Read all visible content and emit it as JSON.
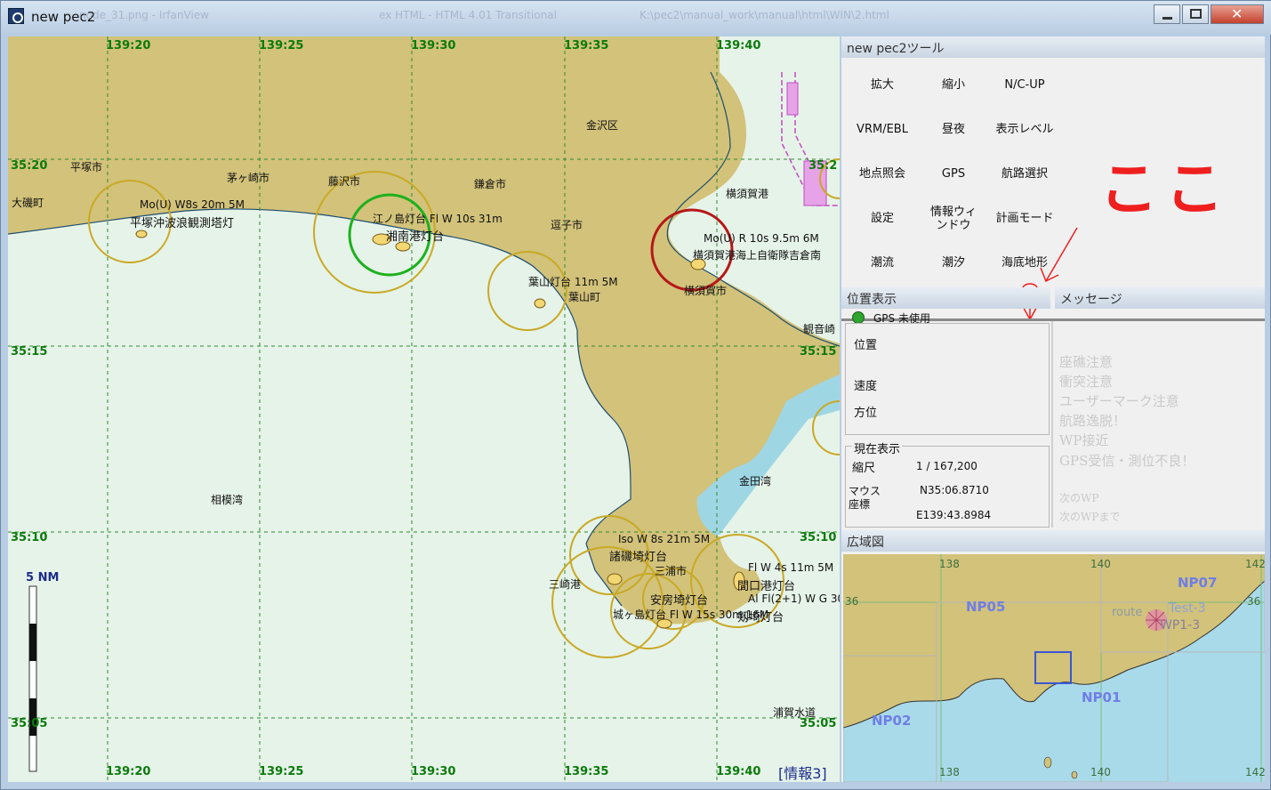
{
  "window": {
    "title": "new pec2",
    "ghost_titles": [
      "node_31.png - IrfanView",
      "ex HTML - HTML 4.01 Transitional",
      "K:\\pec2\\manual_work\\manual\\html\\WIN\\2.html"
    ]
  },
  "map": {
    "top_coords": [
      "139:20",
      "139:25",
      "139:30",
      "139:35",
      "139:40"
    ],
    "bottom_coords": [
      "139:20",
      "139:25",
      "139:30",
      "139:35",
      "139:40"
    ],
    "left_coords": [
      "35:20",
      "35:15",
      "35:10",
      "35:05"
    ],
    "right_coords": [
      "35:2",
      "35:15",
      "35:10",
      "35:05"
    ],
    "place_labels": {
      "hiratsuka": "平塚市",
      "oiso": "大磯町",
      "chigasaki": "茅ヶ崎市",
      "fujisawa": "藤沢市",
      "kamakura": "鎌倉市",
      "kanazawa": "金沢区",
      "zushi": "逗子市",
      "yokosuka_port": "横須賀港",
      "hayama": "葉山町",
      "yokosuka": "横須賀市",
      "kannonzaki": "観音崎",
      "sagami_bay": "相模湾",
      "kaneda_bay": "金田湾",
      "misaki_port": "三崎港",
      "miura": "三浦市",
      "uraga": "浦賀水道"
    },
    "light_labels": {
      "hiratsuka_light": "Mo(U) W8s 20m 5M",
      "hiratsuka_tower": "平塚沖波浪観測塔灯",
      "enoshima": "江ノ島灯台 Fl W 10s 31m",
      "shonan": "湘南港灯台",
      "hayama_light": "葉山灯台 11m 5M",
      "yokosuka_light": "Mo(U) R 10s 9.5m 6M",
      "yokosuka_base": "横須賀港海上自衛隊吉倉南",
      "moroiso_light": "Iso W 8s 21m 5M",
      "moroiso": "諸磯埼灯台",
      "matsuwa_light": "Fl W 4s 11m 5M",
      "mamaguchi": "間口港灯台",
      "tsurugi_light": "Al Fl(2+1) W G 30s",
      "tsurugi": "剱埼灯台",
      "awa": "安房埼灯台",
      "jogashima": "城ヶ島灯台 Fl W 15s 30m 16M"
    },
    "scale_label": "5 NM",
    "info_label": "[情報3]",
    "colors": {
      "land": "#d2c27a",
      "sea": "#e6f3e9",
      "shallow": "#9fd6e4",
      "grid": "#2e8b2e"
    }
  },
  "tools": {
    "header": "new pec2ツール",
    "buttons": [
      {
        "label": "拡大"
      },
      {
        "label": "縮小"
      },
      {
        "label": "N/C-UP"
      },
      {
        "label": "VRM/EBL"
      },
      {
        "label": "昼夜"
      },
      {
        "label": "表示レベル"
      },
      {
        "label": "地点照会"
      },
      {
        "label": "GPS"
      },
      {
        "label": "航路選択"
      },
      {
        "label": "設定"
      },
      {
        "label": "情報ウィンドウ"
      },
      {
        "label": "計画モード"
      },
      {
        "label": "潮流"
      },
      {
        "label": "潮汐"
      },
      {
        "label": "海底地形"
      }
    ],
    "annotation": "ここ"
  },
  "position": {
    "header": "位置表示",
    "gps_status": "GPS 未使用",
    "position_label": "位置",
    "speed_label": "速度",
    "heading_label": "方位"
  },
  "current": {
    "header": "現在表示",
    "scale_label": "縮尺",
    "scale_value": "1 / 167,200",
    "mouse_label_1": "マウス",
    "mouse_label_2": "座標",
    "lat": "N35:06.8710",
    "lon": "E139:43.8984"
  },
  "messages": {
    "header": "メッセージ",
    "items": [
      "座礁注意",
      "衝突注意",
      "ユーザーマーク注意",
      "航路逸脱！",
      "WP接近",
      "GPS受信・測位不良！"
    ],
    "next_wp": "次のWP",
    "next_wp_dist": "次のWPまで"
  },
  "overview": {
    "header": "広域図",
    "lon_top": [
      "138",
      "140",
      "142"
    ],
    "lon_bottom": [
      "138",
      "140",
      "142"
    ],
    "lat": [
      "36",
      "36"
    ],
    "areas": [
      "NP07",
      "NP05",
      "NP01",
      "NP02"
    ],
    "route_label": "route",
    "test_label": "Test-3",
    "wp_label": "WP1-3"
  }
}
